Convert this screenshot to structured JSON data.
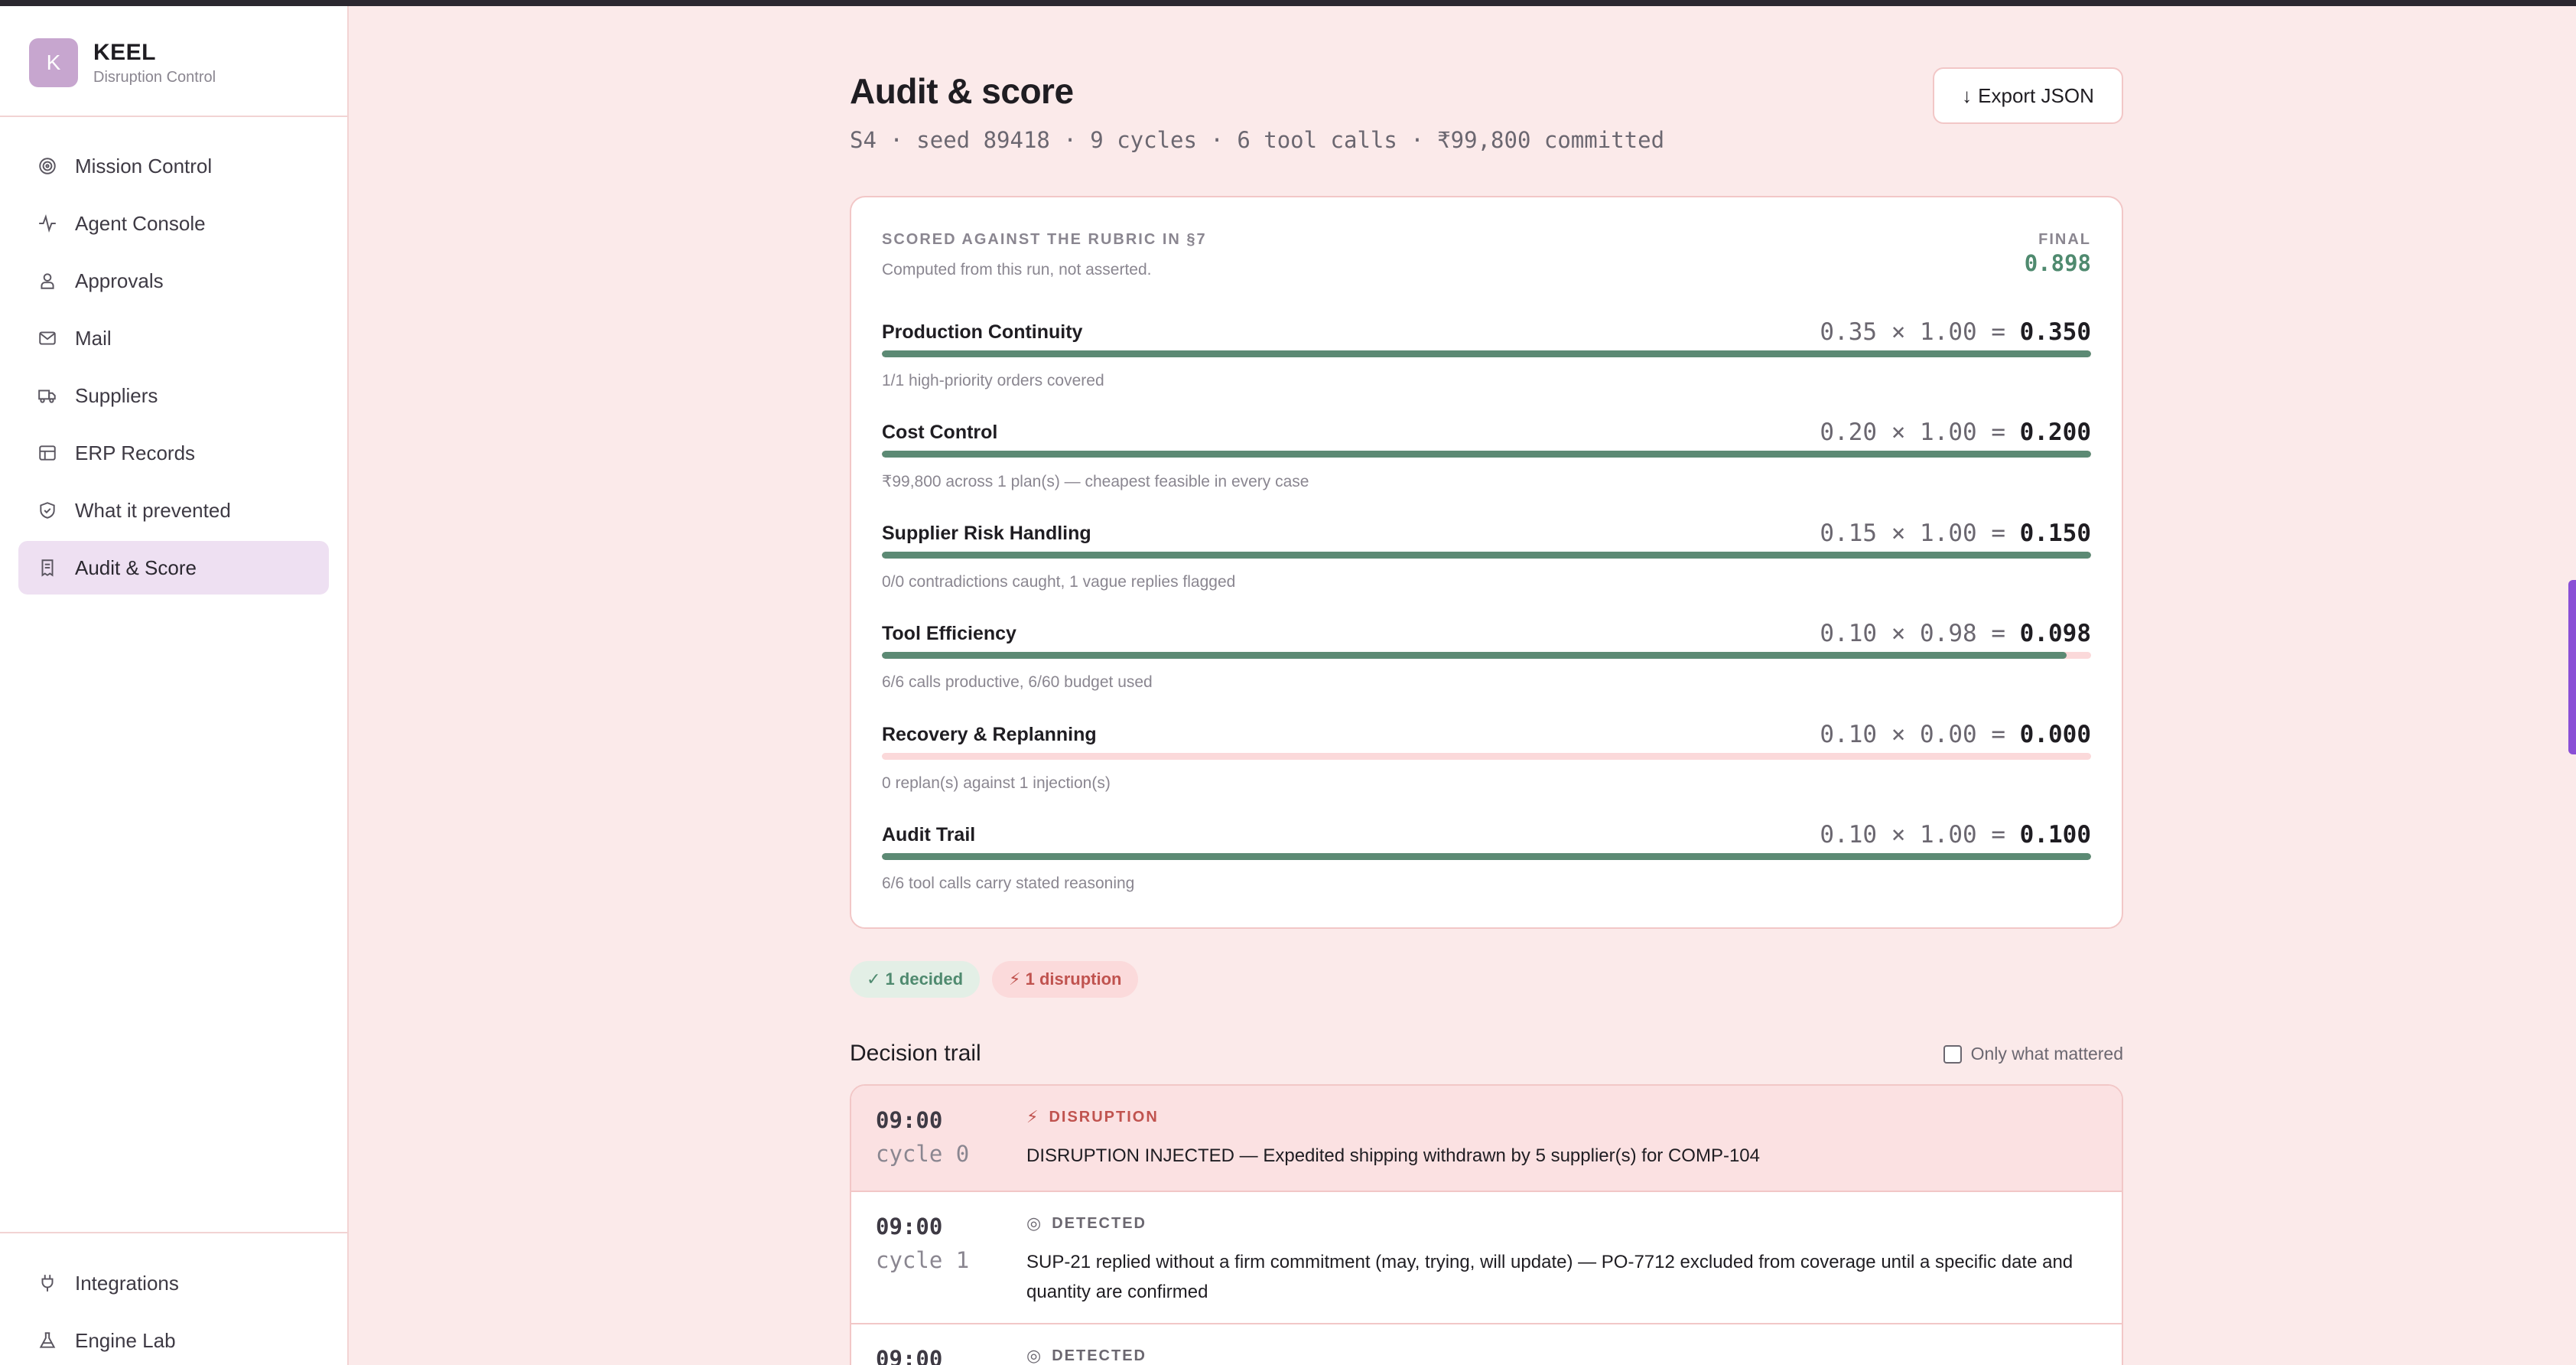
{
  "brand": {
    "logo_letter": "K",
    "name": "KEEL",
    "subtitle": "Disruption Control"
  },
  "sidebar": {
    "items": [
      {
        "label": "Mission Control",
        "icon": "target-icon"
      },
      {
        "label": "Agent Console",
        "icon": "activity-icon"
      },
      {
        "label": "Approvals",
        "icon": "user-check-icon"
      },
      {
        "label": "Mail",
        "icon": "mail-icon"
      },
      {
        "label": "Suppliers",
        "icon": "truck-icon"
      },
      {
        "label": "ERP Records",
        "icon": "table-icon"
      },
      {
        "label": "What it prevented",
        "icon": "shield-icon"
      },
      {
        "label": "Audit & Score",
        "icon": "receipt-icon",
        "active": true
      }
    ],
    "bottom_items": [
      {
        "label": "Integrations",
        "icon": "plug-icon"
      },
      {
        "label": "Engine Lab",
        "icon": "flask-icon"
      }
    ]
  },
  "header": {
    "title": "Audit & score",
    "subtitle": "S4 · seed 89418 · 9 cycles · 6 tool calls · ₹99,800 committed",
    "export_label": "Export JSON"
  },
  "score": {
    "kicker": "SCORED AGAINST THE RUBRIC IN §7",
    "note": "Computed from this run, not asserted.",
    "final_label": "FINAL",
    "final_value": "0.898",
    "metrics": [
      {
        "name": "Production Continuity",
        "formula": "0.35 × 1.00 = ",
        "result": "0.350",
        "fill": 1.0,
        "desc": "1/1 high-priority orders covered"
      },
      {
        "name": "Cost Control",
        "formula": "0.20 × 1.00 = ",
        "result": "0.200",
        "fill": 1.0,
        "desc": "₹99,800 across 1 plan(s) — cheapest feasible in every case"
      },
      {
        "name": "Supplier Risk Handling",
        "formula": "0.15 × 1.00 = ",
        "result": "0.150",
        "fill": 1.0,
        "desc": "0/0 contradictions caught, 1 vague replies flagged"
      },
      {
        "name": "Tool Efficiency",
        "formula": "0.10 × 0.98 = ",
        "result": "0.098",
        "fill": 0.98,
        "desc": "6/6 calls productive, 6/60 budget used"
      },
      {
        "name": "Recovery & Replanning",
        "formula": "0.10 × 0.00 = ",
        "result": "0.000",
        "fill": 0.0,
        "desc": "0 replan(s) against 1 injection(s)"
      },
      {
        "name": "Audit Trail",
        "formula": "0.10 × 1.00 = ",
        "result": "0.100",
        "fill": 1.0,
        "desc": "6/6 tool calls carry stated reasoning"
      }
    ]
  },
  "chips": {
    "decided": "✓ 1 decided",
    "disruption": "⚡ 1 disruption"
  },
  "trail": {
    "title": "Decision trail",
    "toggle_label": "Only what mattered",
    "rows": [
      {
        "time": "09:00",
        "cycle": "cycle 0",
        "kind": "DISRUPTION",
        "kind_icon": "⚡",
        "text": "DISRUPTION INJECTED — Expedited shipping withdrawn by 5 supplier(s) for COMP-104"
      },
      {
        "time": "09:00",
        "cycle": "cycle 1",
        "kind": "DETECTED",
        "kind_icon": "◎",
        "text": "SUP-21 replied without a firm commitment (may, trying, will update) — PO-7712 excluded from coverage until a specific date and quantity are confirmed"
      },
      {
        "time": "09:00",
        "cycle": "",
        "kind": "DETECTED",
        "kind_icon": "◎",
        "text": ""
      }
    ]
  },
  "colors": {
    "accent_green": "#5c8a74",
    "danger": "#c0534f",
    "background": "#fbeaea"
  }
}
